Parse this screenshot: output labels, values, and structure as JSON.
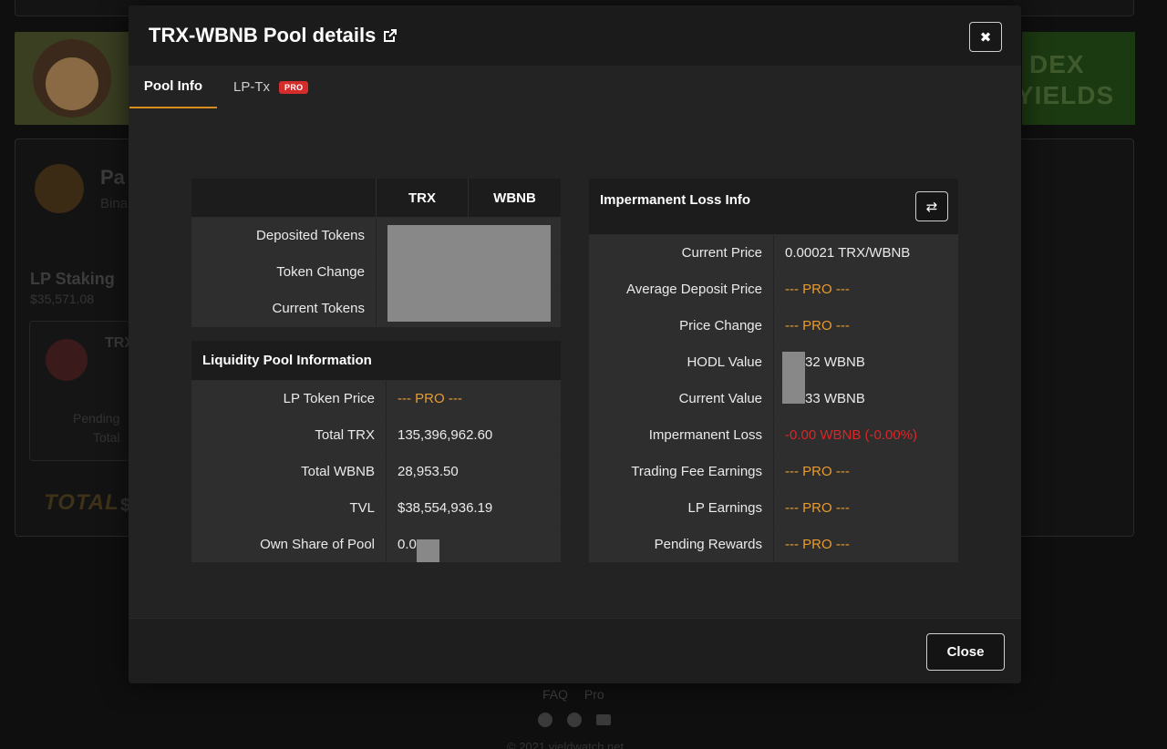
{
  "background": {
    "banner_right_line1": "DEX",
    "banner_right_line2": "YIELDS",
    "card_title_fragment": "Pa",
    "card_subtitle_fragment": "Bina",
    "lp_staking_label": "LP Staking",
    "lp_staking_value": "$35,571.08",
    "inner_token_fragment": "TRX",
    "pending_label": "Pending",
    "total_label": "Total",
    "total_banner": "TOTAL",
    "footer_links": [
      "FAQ",
      "Pro"
    ],
    "copyright": "© 2021 yieldwatch.net"
  },
  "modal": {
    "title": "TRX-WBNB Pool details",
    "close_x_label": "✖",
    "tabs": [
      {
        "label": "Pool Info",
        "active": true
      },
      {
        "label": "LP-Tx",
        "badge": "PRO"
      }
    ],
    "token_table": {
      "headers": [
        "TRX",
        "WBNB"
      ],
      "rows": [
        {
          "label": "Deposited Tokens"
        },
        {
          "label": "Token Change"
        },
        {
          "label": "Current Tokens"
        }
      ]
    },
    "liquidity_table": {
      "title": "Liquidity Pool Information",
      "rows": [
        {
          "label": "LP Token Price",
          "value": "--- PRO ---"
        },
        {
          "label": "Total TRX",
          "value": "135,396,962.60"
        },
        {
          "label": "Total WBNB",
          "value": "28,953.50"
        },
        {
          "label": "TVL",
          "value": "$38,554,936.19"
        },
        {
          "label": "Own Share of Pool",
          "value": "0.0"
        }
      ]
    },
    "impermanent_table": {
      "title": "Impermanent Loss Info",
      "swap_label": "⇄",
      "rows": [
        {
          "label": "Current Price",
          "value": "0.00021 TRX/WBNB"
        },
        {
          "label": "Average Deposit Price",
          "value": "--- PRO ---"
        },
        {
          "label": "Price Change",
          "value": "--- PRO ---"
        },
        {
          "label": "HODL Value",
          "value": "32 WBNB"
        },
        {
          "label": "Current Value",
          "value": "33 WBNB"
        },
        {
          "label": "Impermanent Loss",
          "value": "-0.00 WBNB (-0.00%)"
        },
        {
          "label": "Trading Fee Earnings",
          "value": "--- PRO ---"
        },
        {
          "label": "LP Earnings",
          "value": "--- PRO ---"
        },
        {
          "label": "Pending Rewards",
          "value": "--- PRO ---"
        }
      ]
    },
    "close_button_label": "Close"
  },
  "colors": {
    "accent_tab_underline": "#d98c1e",
    "pro_text": "#e89a2e",
    "loss_text": "#d62828",
    "pro_badge": "#d42b2b"
  }
}
